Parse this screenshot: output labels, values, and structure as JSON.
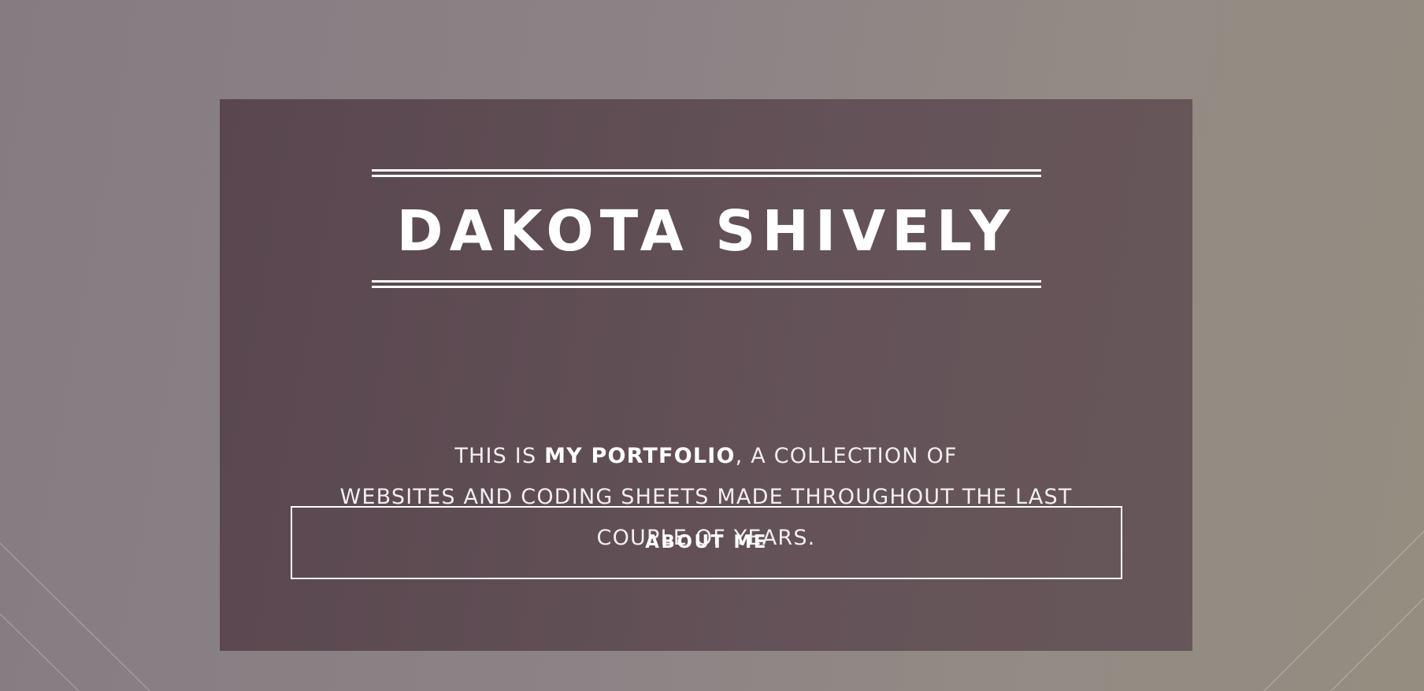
{
  "hero": {
    "title": "DAKOTA SHIVELY",
    "intro": {
      "prefix": "THIS IS ",
      "highlight": "MY PORTFOLIO",
      "after_highlight": ", A COLLECTION OF",
      "line2": "WEBSITES AND CODING SHEETS MADE THROUGHOUT THE LAST",
      "line3": "COUPLE OF YEARS."
    },
    "button_label": "ABOUT ME"
  },
  "colors": {
    "page_background": "#8c8386",
    "hero_box": "#5e4c55",
    "text": "#ffffff"
  }
}
